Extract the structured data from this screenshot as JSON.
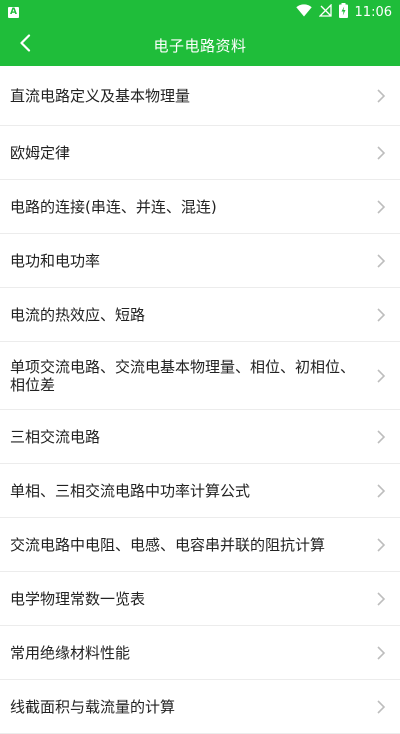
{
  "status_bar": {
    "app_icon_label": "A",
    "time": "11:06"
  },
  "header": {
    "title": "电子电路资料"
  },
  "list": {
    "items": [
      "直流电路定义及基本物理量",
      "欧姆定律",
      "电路的连接(串连、并连、混连)",
      "电功和电功率",
      "电流的热效应、短路",
      "单项交流电路、交流电基本物理量、相位、初相位、相位差",
      "三相交流电路",
      "单相、三相交流电路中功率计算公式",
      "交流电路中电阻、电感、电容串并联的阻抗计算",
      "电学物理常数一览表",
      "常用绝缘材料性能",
      "线截面积与载流量的计算"
    ]
  },
  "colors": {
    "brand_green": "#1fbd3a",
    "chevron": "#bdbdbd"
  }
}
